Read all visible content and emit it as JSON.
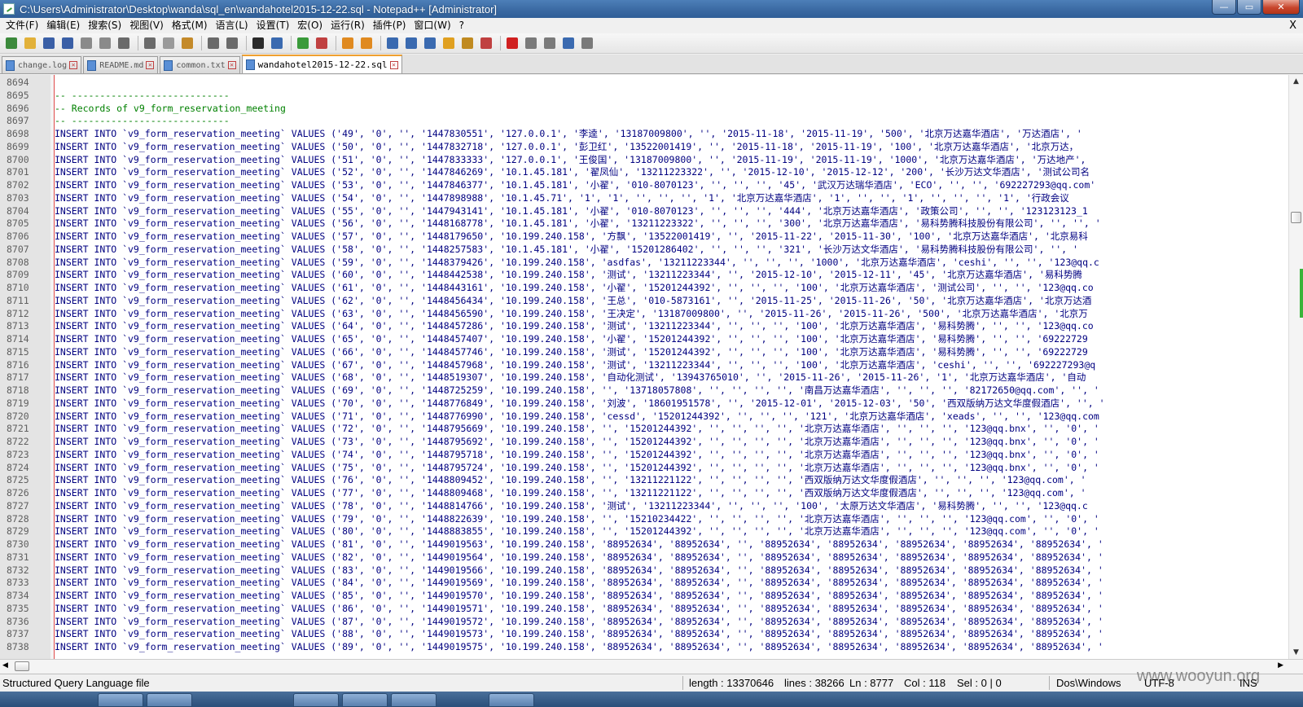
{
  "window": {
    "title": "C:\\Users\\Administrator\\Desktop\\wanda\\sql_en\\wandahotel2015-12-22.sql - Notepad++ [Administrator]",
    "buttons": [
      "—",
      "▭",
      "✕"
    ]
  },
  "menu": {
    "items": [
      "文件(F)",
      "编辑(E)",
      "搜索(S)",
      "视图(V)",
      "格式(M)",
      "语言(L)",
      "设置(T)",
      "宏(O)",
      "运行(R)",
      "插件(P)",
      "窗口(W)",
      "?"
    ],
    "close_glyph": "X"
  },
  "toolbar": {
    "icons": [
      "new-file-icon",
      "open-file-icon",
      "save-icon",
      "save-all-icon",
      "close-icon",
      "close-all-icon",
      "print-icon",
      "cut-icon",
      "copy-icon",
      "paste-icon",
      "undo-icon",
      "redo-icon",
      "find-icon",
      "replace-icon",
      "zoom-in-icon",
      "zoom-out-icon",
      "sync-v-icon",
      "sync-h-icon",
      "wrap-icon",
      "all-chars-icon",
      "indent-guide-icon",
      "udl-icon",
      "doc-map-icon",
      "function-list-icon",
      "record-macro-icon",
      "stop-record-icon",
      "play-macro-icon",
      "run-macro-multiple-icon",
      "save-macro-icon"
    ],
    "colors": [
      "#3c8a3c",
      "#e2b13a",
      "#3a5fa6",
      "#3a5fa6",
      "#8a8a8a",
      "#8a8a8a",
      "#6a6a6a",
      "#6a6a6a",
      "#9a9a9a",
      "#c48a2a",
      "#6a6a6a",
      "#6a6a6a",
      "#2a2a2a",
      "#3a6ab0",
      "#3a9a3a",
      "#c04040",
      "#e08a20",
      "#e08a20",
      "#3a6ab0",
      "#3a6ab0",
      "#3a6ab0",
      "#e0a020",
      "#c08a20",
      "#c04040",
      "#d02020",
      "#7a7a7a",
      "#7a7a7a",
      "#3a6ab0",
      "#7a7a7a"
    ]
  },
  "tabs": [
    {
      "label": "change.log",
      "active": false
    },
    {
      "label": "README.md",
      "active": false
    },
    {
      "label": "common.txt",
      "active": false
    },
    {
      "label": "wandahotel2015-12-22.sql",
      "active": true
    }
  ],
  "editor": {
    "lines": [
      {
        "n": "8694",
        "text": "",
        "kind": "sql"
      },
      {
        "n": "8695",
        "text": "-- ----------------------------",
        "kind": "comment"
      },
      {
        "n": "8696",
        "text": "-- Records of v9_form_reservation_meeting",
        "kind": "comment"
      },
      {
        "n": "8697",
        "text": "-- ----------------------------",
        "kind": "comment"
      },
      {
        "n": "8698",
        "text": "INSERT INTO `v9_form_reservation_meeting` VALUES ('49', '0', '', '1447830551', '127.0.0.1', '李逵', '13187009800', '', '2015-11-18', '2015-11-19', '500', '北京万达嘉华酒店', '万达酒店', '",
        "kind": "sql"
      },
      {
        "n": "8699",
        "text": "INSERT INTO `v9_form_reservation_meeting` VALUES ('50', '0', '', '1447832718', '127.0.0.1', '彭卫红', '13522001419', '', '2015-11-18', '2015-11-19', '100', '北京万达嘉华酒店', '北京万达，",
        "kind": "sql"
      },
      {
        "n": "8700",
        "text": "INSERT INTO `v9_form_reservation_meeting` VALUES ('51', '0', '', '1447833333', '127.0.0.1', '王俊国', '13187009800', '', '2015-11-19', '2015-11-19', '1000', '北京万达嘉华酒店', '万达地产',",
        "kind": "sql"
      },
      {
        "n": "8701",
        "text": "INSERT INTO `v9_form_reservation_meeting` VALUES ('52', '0', '', '1447846269', '10.1.45.181', '翟凤仙', '13211223322', '', '2015-12-10', '2015-12-12', '200', '长沙万达文华酒店', '测试公司名",
        "kind": "sql"
      },
      {
        "n": "8702",
        "text": "INSERT INTO `v9_form_reservation_meeting` VALUES ('53', '0', '', '1447846377', '10.1.45.181', '小翟', '010-8070123', '', '', '', '45', '武汉万达瑞华酒店', 'ECO', '', '', '692227293@qq.com'",
        "kind": "sql"
      },
      {
        "n": "8703",
        "text": "INSERT INTO `v9_form_reservation_meeting` VALUES ('54', '0', '', '1447898988', '10.1.45.71', '1', '1', '', '', '', '1', '北京万达嘉华酒店', '1', '', '', '1', '', '', '', '1', '行政会议",
        "kind": "sql"
      },
      {
        "n": "8704",
        "text": "INSERT INTO `v9_form_reservation_meeting` VALUES ('55', '0', '', '1447943141', '10.1.45.181', '小翟', '010-8070123', '', '', '', '444', '北京万达嘉华酒店', '政策公司', '', '', '123123123_1",
        "kind": "sql"
      },
      {
        "n": "8705",
        "text": "INSERT INTO `v9_form_reservation_meeting` VALUES ('56', '0', '', '1448168778', '10.1.45.181', '小翟', '13211223322', '', '', '', '300', '北京万达嘉华酒店', '易科势腾科技股份有限公司', '', '', '",
        "kind": "sql"
      },
      {
        "n": "8706",
        "text": "INSERT INTO `v9_form_reservation_meeting` VALUES ('57', '0', '', '1448179650', '10.199.240.158', '方飘', '13522001419', '', '2015-11-22', '2015-11-30', '100', '北京万达嘉华酒店', '北京易科",
        "kind": "sql"
      },
      {
        "n": "8707",
        "text": "INSERT INTO `v9_form_reservation_meeting` VALUES ('58', '0', '', '1448257583', '10.1.45.181', '小翟', '15201286402', '', '', '', '321', '长沙万达文华酒店', '易科势腾科技股份有限公司', '', '",
        "kind": "sql"
      },
      {
        "n": "8708",
        "text": "INSERT INTO `v9_form_reservation_meeting` VALUES ('59', '0', '', '1448379426', '10.199.240.158', 'asdfas', '13211223344', '', '', '', '1000', '北京万达嘉华酒店', 'ceshi', '', '', '123@qq.c",
        "kind": "sql"
      },
      {
        "n": "8709",
        "text": "INSERT INTO `v9_form_reservation_meeting` VALUES ('60', '0', '', '1448442538', '10.199.240.158', '测试', '13211223344', '', '2015-12-10', '2015-12-11', '45', '北京万达嘉华酒店', '易科势腾",
        "kind": "sql"
      },
      {
        "n": "8710",
        "text": "INSERT INTO `v9_form_reservation_meeting` VALUES ('61', '0', '', '1448443161', '10.199.240.158', '小翟', '15201244392', '', '', '', '100', '北京万达嘉华酒店', '测试公司', '', '', '123@qq.co",
        "kind": "sql"
      },
      {
        "n": "8711",
        "text": "INSERT INTO `v9_form_reservation_meeting` VALUES ('62', '0', '', '1448456434', '10.199.240.158', '王总', '010-5873161', '', '2015-11-25', '2015-11-26', '50', '北京万达嘉华酒店', '北京万达酒",
        "kind": "sql"
      },
      {
        "n": "8712",
        "text": "INSERT INTO `v9_form_reservation_meeting` VALUES ('63', '0', '', '1448456590', '10.199.240.158', '王决定', '13187009800', '', '2015-11-26', '2015-11-26', '500', '北京万达嘉华酒店', '北京万",
        "kind": "sql"
      },
      {
        "n": "8713",
        "text": "INSERT INTO `v9_form_reservation_meeting` VALUES ('64', '0', '', '1448457286', '10.199.240.158', '测试', '13211223344', '', '', '', '100', '北京万达嘉华酒店', '易科势腾', '', '', '123@qq.co",
        "kind": "sql"
      },
      {
        "n": "8714",
        "text": "INSERT INTO `v9_form_reservation_meeting` VALUES ('65', '0', '', '1448457407', '10.199.240.158', '小翟', '15201244392', '', '', '', '100', '北京万达嘉华酒店', '易科势腾', '', '', '69222729",
        "kind": "sql"
      },
      {
        "n": "8715",
        "text": "INSERT INTO `v9_form_reservation_meeting` VALUES ('66', '0', '', '1448457746', '10.199.240.158', '测试', '15201244392', '', '', '', '100', '北京万达嘉华酒店', '易科势腾', '', '', '69222729",
        "kind": "sql"
      },
      {
        "n": "8716",
        "text": "INSERT INTO `v9_form_reservation_meeting` VALUES ('67', '0', '', '1448457968', '10.199.240.158', '测试', '13211223344', '', '', '', '100', '北京万达嘉华酒店', 'ceshi', '', '', '692227293@q",
        "kind": "sql"
      },
      {
        "n": "8717",
        "text": "INSERT INTO `v9_form_reservation_meeting` VALUES ('68', '0', '', '1448519307', '10.199.240.158', '自动化测试', '13943765010', '', '2015-11-26', '2015-11-26', '1', '北京万达嘉华酒店', '自动",
        "kind": "sql"
      },
      {
        "n": "8718",
        "text": "INSERT INTO `v9_form_reservation_meeting` VALUES ('69', '0', '', '1448725259', '10.199.240.158', '', '13718057808', '', '', '', '', '南昌万达嘉华酒店', '', '', '', '82172650@qq.com', '', '",
        "kind": "sql"
      },
      {
        "n": "8719",
        "text": "INSERT INTO `v9_form_reservation_meeting` VALUES ('70', '0', '', '1448776849', '10.199.240.158', '刘波', '18601951578', '', '2015-12-01', '2015-12-03', '50', '西双版纳万达文华度假酒店', '', '",
        "kind": "sql"
      },
      {
        "n": "8720",
        "text": "INSERT INTO `v9_form_reservation_meeting` VALUES ('71', '0', '', '1448776990', '10.199.240.158', 'cessd', '15201244392', '', '', '', '121', '北京万达嘉华酒店', 'xeads', '', '', '123@qq.com",
        "kind": "sql"
      },
      {
        "n": "8721",
        "text": "INSERT INTO `v9_form_reservation_meeting` VALUES ('72', '0', '', '1448795669', '10.199.240.158', '', '15201244392', '', '', '', '', '北京万达嘉华酒店', '', '', '', '123@qq.bnx', '', '0', '",
        "kind": "sql"
      },
      {
        "n": "8722",
        "text": "INSERT INTO `v9_form_reservation_meeting` VALUES ('73', '0', '', '1448795692', '10.199.240.158', '', '15201244392', '', '', '', '', '北京万达嘉华酒店', '', '', '', '123@qq.bnx', '', '0', '",
        "kind": "sql"
      },
      {
        "n": "8723",
        "text": "INSERT INTO `v9_form_reservation_meeting` VALUES ('74', '0', '', '1448795718', '10.199.240.158', '', '15201244392', '', '', '', '', '北京万达嘉华酒店', '', '', '', '123@qq.bnx', '', '0', '",
        "kind": "sql"
      },
      {
        "n": "8724",
        "text": "INSERT INTO `v9_form_reservation_meeting` VALUES ('75', '0', '', '1448795724', '10.199.240.158', '', '15201244392', '', '', '', '', '北京万达嘉华酒店', '', '', '', '123@qq.bnx', '', '0', '",
        "kind": "sql"
      },
      {
        "n": "8725",
        "text": "INSERT INTO `v9_form_reservation_meeting` VALUES ('76', '0', '', '1448809452', '10.199.240.158', '', '13211221122', '', '', '', '', '西双版纳万达文华度假酒店', '', '', '', '123@qq.com', '",
        "kind": "sql"
      },
      {
        "n": "8726",
        "text": "INSERT INTO `v9_form_reservation_meeting` VALUES ('77', '0', '', '1448809468', '10.199.240.158', '', '13211221122', '', '', '', '', '西双版纳万达文华度假酒店', '', '', '', '123@qq.com', '",
        "kind": "sql"
      },
      {
        "n": "8727",
        "text": "INSERT INTO `v9_form_reservation_meeting` VALUES ('78', '0', '', '1448814766', '10.199.240.158', '测试', '13211223344', '', '', '', '100', '太原万达文华酒店', '易科势腾', '', '', '123@qq.c",
        "kind": "sql"
      },
      {
        "n": "8728",
        "text": "INSERT INTO `v9_form_reservation_meeting` VALUES ('79', '0', '', '1448822639', '10.199.240.158', '', '15210234422', '', '', '', '', '北京万达嘉华酒店', '', '', '', '123@qq.com', '', '0', '",
        "kind": "sql"
      },
      {
        "n": "8729",
        "text": "INSERT INTO `v9_form_reservation_meeting` VALUES ('80', '0', '', '1448883855', '10.199.240.158', '', '15201244392', '', '', '', '', '北京万达嘉华酒店', '', '', '', '123@qq.com', '', '0', '",
        "kind": "sql"
      },
      {
        "n": "8730",
        "text": "INSERT INTO `v9_form_reservation_meeting` VALUES ('81', '0', '', '1449019563', '10.199.240.158', '88952634', '88952634', '', '88952634', '88952634', '88952634', '88952634', '88952634', '",
        "kind": "sql"
      },
      {
        "n": "8731",
        "text": "INSERT INTO `v9_form_reservation_meeting` VALUES ('82', '0', '', '1449019564', '10.199.240.158', '88952634', '88952634', '', '88952634', '88952634', '88952634', '88952634', '88952634', '",
        "kind": "sql"
      },
      {
        "n": "8732",
        "text": "INSERT INTO `v9_form_reservation_meeting` VALUES ('83', '0', '', '1449019566', '10.199.240.158', '88952634', '88952634', '', '88952634', '88952634', '88952634', '88952634', '88952634', '",
        "kind": "sql"
      },
      {
        "n": "8733",
        "text": "INSERT INTO `v9_form_reservation_meeting` VALUES ('84', '0', '', '1449019569', '10.199.240.158', '88952634', '88952634', '', '88952634', '88952634', '88952634', '88952634', '88952634', '",
        "kind": "sql"
      },
      {
        "n": "8734",
        "text": "INSERT INTO `v9_form_reservation_meeting` VALUES ('85', '0', '', '1449019570', '10.199.240.158', '88952634', '88952634', '', '88952634', '88952634', '88952634', '88952634', '88952634', '",
        "kind": "sql"
      },
      {
        "n": "8735",
        "text": "INSERT INTO `v9_form_reservation_meeting` VALUES ('86', '0', '', '1449019571', '10.199.240.158', '88952634', '88952634', '', '88952634', '88952634', '88952634', '88952634', '88952634', '",
        "kind": "sql"
      },
      {
        "n": "8736",
        "text": "INSERT INTO `v9_form_reservation_meeting` VALUES ('87', '0', '', '1449019572', '10.199.240.158', '88952634', '88952634', '', '88952634', '88952634', '88952634', '88952634', '88952634', '",
        "kind": "sql"
      },
      {
        "n": "8737",
        "text": "INSERT INTO `v9_form_reservation_meeting` VALUES ('88', '0', '', '1449019573', '10.199.240.158', '88952634', '88952634', '', '88952634', '88952634', '88952634', '88952634', '88952634', '",
        "kind": "sql"
      },
      {
        "n": "8738",
        "text": "INSERT INTO `v9_form_reservation_meeting` VALUES ('89', '0', '', '1449019575', '10.199.240.158', '88952634', '88952634', '', '88952634', '88952634', '88952634', '88952634', '88952634', '",
        "kind": "sql"
      }
    ]
  },
  "scrollbar": {
    "up": "▲",
    "down": "▼",
    "left": "◀",
    "right": "▶"
  },
  "status": {
    "file_type": "Structured Query Language file",
    "length": "length : 13370646",
    "lines": "lines : 38266",
    "ln": "Ln : 8777",
    "col": "Col : 118",
    "sel": "Sel : 0 | 0",
    "eol": "Dos\\Windows",
    "encoding": "UTF-8",
    "mode": "INS"
  },
  "watermark": "www.wooyun.org"
}
